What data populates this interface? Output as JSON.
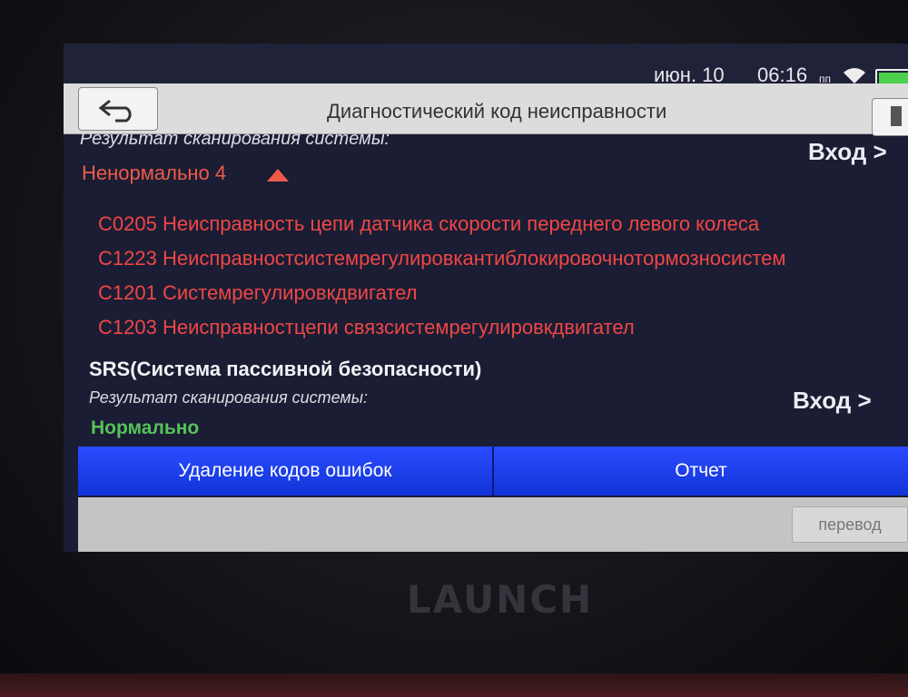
{
  "status_bar": {
    "date": "июн. 10",
    "time": "06:16",
    "ampm": "пп"
  },
  "header": {
    "title": "Диагностический код неисправности"
  },
  "scan": {
    "result_label_top": "Результат сканирования системы:",
    "enter_label": "Вход >",
    "abnormal_label": "Ненормально 4",
    "faults": [
      "C0205 Неисправность цепи датчика скорости переднего левого колеса",
      "C1223 Неисправностсистемрегулировкантиблокировочнотормозносистем",
      "C1201 Системрегулировкдвигател",
      "C1203 Неисправностцепи связсистемрегулировкдвигател"
    ]
  },
  "srs": {
    "title": "SRS(Система пассивной безопасности)",
    "result_label": "Результат сканирования системы:",
    "enter_label": "Вход >",
    "status": "Нормально"
  },
  "actions": {
    "clear_codes": "Удаление кодов ошибок",
    "report": "Отчет",
    "translate": "перевод"
  },
  "device": {
    "brand": "LAUNCH"
  },
  "colors": {
    "fault_red": "#f04646",
    "ok_green": "#55c25a",
    "action_blue": "#1535e0"
  }
}
